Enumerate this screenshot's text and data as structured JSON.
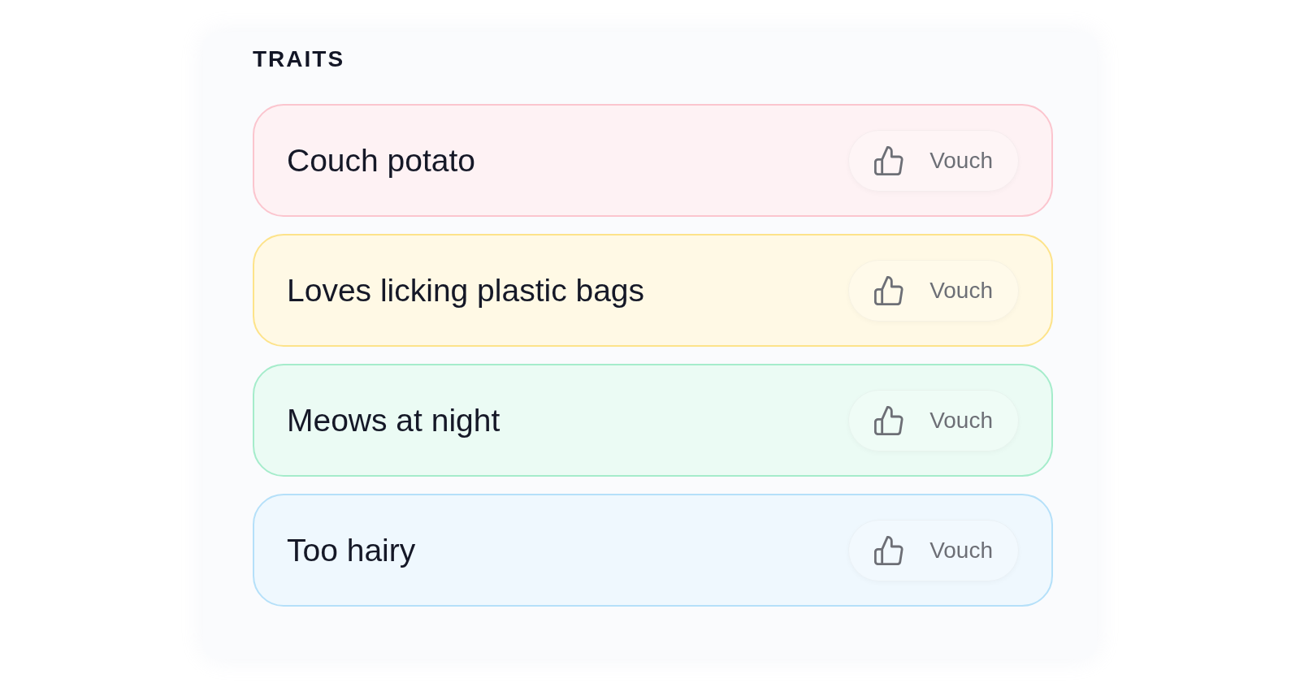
{
  "section": {
    "title": "TRAITS"
  },
  "traits": [
    {
      "label": "Couch potato",
      "color": "#fbc5ce",
      "button": "Vouch"
    },
    {
      "label": "Loves licking plastic bags",
      "color": "#fde38a",
      "button": "Vouch"
    },
    {
      "label": "Meows at night",
      "color": "#a5eccb",
      "button": "Vouch"
    },
    {
      "label": "Too hairy",
      "color": "#b5e0f9",
      "button": "Vouch"
    }
  ]
}
